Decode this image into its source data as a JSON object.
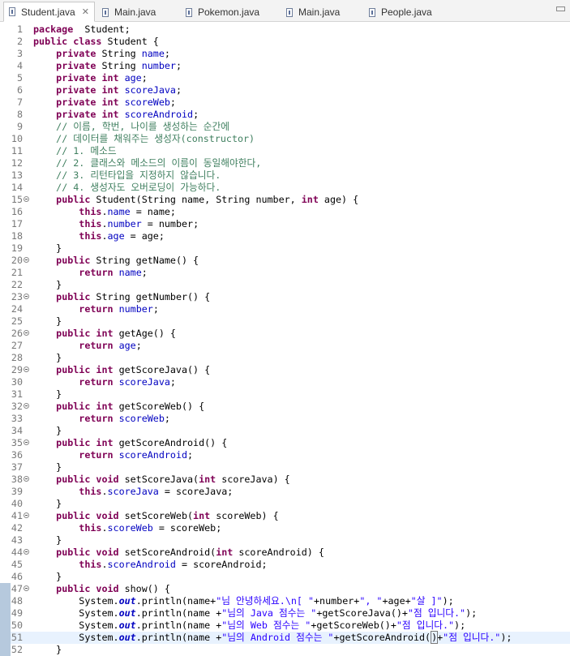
{
  "tabs": [
    {
      "label": "Student.java",
      "active": true,
      "close": "✕"
    },
    {
      "label": "Main.java",
      "active": false
    },
    {
      "label": "Pokemon.java",
      "active": false
    },
    {
      "label": "Main.java",
      "active": false
    },
    {
      "label": "People.java",
      "active": false
    }
  ],
  "code_lines": [
    {
      "n": "1",
      "t": [
        [
          "kw",
          "package"
        ],
        [
          "",
          "  Student;"
        ]
      ]
    },
    {
      "n": "2",
      "t": [
        [
          "kw",
          "public class"
        ],
        [
          "",
          " Student {"
        ]
      ]
    },
    {
      "n": "3",
      "t": [
        [
          "",
          "    "
        ],
        [
          "kw",
          "private"
        ],
        [
          "",
          " String "
        ],
        [
          "fld",
          "name"
        ],
        [
          "",
          ";"
        ]
      ]
    },
    {
      "n": "4",
      "t": [
        [
          "",
          "    "
        ],
        [
          "kw",
          "private"
        ],
        [
          "",
          " String "
        ],
        [
          "fld",
          "number"
        ],
        [
          "",
          ";"
        ]
      ]
    },
    {
      "n": "5",
      "t": [
        [
          "",
          "    "
        ],
        [
          "kw",
          "private int"
        ],
        [
          "",
          " "
        ],
        [
          "fld",
          "age"
        ],
        [
          "",
          ";"
        ]
      ]
    },
    {
      "n": "6",
      "t": [
        [
          "",
          "    "
        ],
        [
          "kw",
          "private int"
        ],
        [
          "",
          " "
        ],
        [
          "fld",
          "scoreJava"
        ],
        [
          "",
          ";"
        ]
      ]
    },
    {
      "n": "7",
      "t": [
        [
          "",
          "    "
        ],
        [
          "kw",
          "private int"
        ],
        [
          "",
          " "
        ],
        [
          "fld",
          "scoreWeb"
        ],
        [
          "",
          ";"
        ]
      ]
    },
    {
      "n": "8",
      "t": [
        [
          "",
          "    "
        ],
        [
          "kw",
          "private int"
        ],
        [
          "",
          " "
        ],
        [
          "fld",
          "scoreAndroid"
        ],
        [
          "",
          ";"
        ]
      ]
    },
    {
      "n": "9",
      "t": [
        [
          "",
          "    "
        ],
        [
          "cmt",
          "// 이름, 학번, 나이를 생성하는 순간에"
        ]
      ]
    },
    {
      "n": "10",
      "t": [
        [
          "",
          "    "
        ],
        [
          "cmt",
          "// 데이터를 채워주는 생성자(constructor)"
        ]
      ]
    },
    {
      "n": "11",
      "t": [
        [
          "",
          "    "
        ],
        [
          "cmt",
          "// 1. 메소드"
        ]
      ]
    },
    {
      "n": "12",
      "t": [
        [
          "",
          "    "
        ],
        [
          "cmt",
          "// 2. 클래스와 메소드의 이름이 동일해야한다,"
        ]
      ]
    },
    {
      "n": "13",
      "t": [
        [
          "",
          "    "
        ],
        [
          "cmt",
          "// 3. 리턴타입을 지정하지 않습니다."
        ]
      ]
    },
    {
      "n": "14",
      "t": [
        [
          "",
          "    "
        ],
        [
          "cmt",
          "// 4. 생성자도 오버로딩이 가능하다."
        ]
      ]
    },
    {
      "n": "15",
      "fold": true,
      "t": [
        [
          "",
          "    "
        ],
        [
          "kw",
          "public"
        ],
        [
          "",
          " Student(String name, String number, "
        ],
        [
          "kw",
          "int"
        ],
        [
          "",
          " age) {"
        ]
      ]
    },
    {
      "n": "16",
      "t": [
        [
          "",
          "        "
        ],
        [
          "kw",
          "this"
        ],
        [
          "",
          "."
        ],
        [
          "fld",
          "name"
        ],
        [
          "",
          " = name;"
        ]
      ]
    },
    {
      "n": "17",
      "t": [
        [
          "",
          "        "
        ],
        [
          "kw",
          "this"
        ],
        [
          "",
          "."
        ],
        [
          "fld",
          "number"
        ],
        [
          "",
          " = number;"
        ]
      ]
    },
    {
      "n": "18",
      "t": [
        [
          "",
          "        "
        ],
        [
          "kw",
          "this"
        ],
        [
          "",
          "."
        ],
        [
          "fld",
          "age"
        ],
        [
          "",
          " = age;"
        ]
      ]
    },
    {
      "n": "19",
      "t": [
        [
          "",
          "    }"
        ]
      ]
    },
    {
      "n": "20",
      "fold": true,
      "t": [
        [
          "",
          "    "
        ],
        [
          "kw",
          "public"
        ],
        [
          "",
          " String getName() {"
        ]
      ]
    },
    {
      "n": "21",
      "t": [
        [
          "",
          "        "
        ],
        [
          "kw",
          "return"
        ],
        [
          "",
          " "
        ],
        [
          "fld",
          "name"
        ],
        [
          "",
          ";"
        ]
      ]
    },
    {
      "n": "22",
      "t": [
        [
          "",
          "    }"
        ]
      ]
    },
    {
      "n": "23",
      "fold": true,
      "t": [
        [
          "",
          "    "
        ],
        [
          "kw",
          "public"
        ],
        [
          "",
          " String getNumber() {"
        ]
      ]
    },
    {
      "n": "24",
      "t": [
        [
          "",
          "        "
        ],
        [
          "kw",
          "return"
        ],
        [
          "",
          " "
        ],
        [
          "fld",
          "number"
        ],
        [
          "",
          ";"
        ]
      ]
    },
    {
      "n": "25",
      "t": [
        [
          "",
          "    }"
        ]
      ]
    },
    {
      "n": "26",
      "fold": true,
      "t": [
        [
          "",
          "    "
        ],
        [
          "kw",
          "public int"
        ],
        [
          "",
          " getAge() {"
        ]
      ]
    },
    {
      "n": "27",
      "t": [
        [
          "",
          "        "
        ],
        [
          "kw",
          "return"
        ],
        [
          "",
          " "
        ],
        [
          "fld",
          "age"
        ],
        [
          "",
          ";"
        ]
      ]
    },
    {
      "n": "28",
      "t": [
        [
          "",
          "    }"
        ]
      ]
    },
    {
      "n": "29",
      "fold": true,
      "t": [
        [
          "",
          "    "
        ],
        [
          "kw",
          "public int"
        ],
        [
          "",
          " getScoreJava() {"
        ]
      ]
    },
    {
      "n": "30",
      "t": [
        [
          "",
          "        "
        ],
        [
          "kw",
          "return"
        ],
        [
          "",
          " "
        ],
        [
          "fld",
          "scoreJava"
        ],
        [
          "",
          ";"
        ]
      ]
    },
    {
      "n": "31",
      "t": [
        [
          "",
          "    }"
        ]
      ]
    },
    {
      "n": "32",
      "fold": true,
      "t": [
        [
          "",
          "    "
        ],
        [
          "kw",
          "public int"
        ],
        [
          "",
          " getScoreWeb() {"
        ]
      ]
    },
    {
      "n": "33",
      "t": [
        [
          "",
          "        "
        ],
        [
          "kw",
          "return"
        ],
        [
          "",
          " "
        ],
        [
          "fld",
          "scoreWeb"
        ],
        [
          "",
          ";"
        ]
      ]
    },
    {
      "n": "34",
      "t": [
        [
          "",
          "    }"
        ]
      ]
    },
    {
      "n": "35",
      "fold": true,
      "t": [
        [
          "",
          "    "
        ],
        [
          "kw",
          "public int"
        ],
        [
          "",
          " getScoreAndroid() {"
        ]
      ]
    },
    {
      "n": "36",
      "t": [
        [
          "",
          "        "
        ],
        [
          "kw",
          "return"
        ],
        [
          "",
          " "
        ],
        [
          "fld",
          "scoreAndroid"
        ],
        [
          "",
          ";"
        ]
      ]
    },
    {
      "n": "37",
      "t": [
        [
          "",
          "    }"
        ]
      ]
    },
    {
      "n": "38",
      "fold": true,
      "t": [
        [
          "",
          "    "
        ],
        [
          "kw",
          "public void"
        ],
        [
          "",
          " setScoreJava("
        ],
        [
          "kw",
          "int"
        ],
        [
          "",
          " scoreJava) {"
        ]
      ]
    },
    {
      "n": "39",
      "t": [
        [
          "",
          "        "
        ],
        [
          "kw",
          "this"
        ],
        [
          "",
          "."
        ],
        [
          "fld",
          "scoreJava"
        ],
        [
          "",
          " = scoreJava;"
        ]
      ]
    },
    {
      "n": "40",
      "t": [
        [
          "",
          "    }"
        ]
      ]
    },
    {
      "n": "41",
      "fold": true,
      "t": [
        [
          "",
          "    "
        ],
        [
          "kw",
          "public void"
        ],
        [
          "",
          " setScoreWeb("
        ],
        [
          "kw",
          "int"
        ],
        [
          "",
          " scoreWeb) {"
        ]
      ]
    },
    {
      "n": "42",
      "t": [
        [
          "",
          "        "
        ],
        [
          "kw",
          "this"
        ],
        [
          "",
          "."
        ],
        [
          "fld",
          "scoreWeb"
        ],
        [
          "",
          " = scoreWeb;"
        ]
      ]
    },
    {
      "n": "43",
      "t": [
        [
          "",
          "    }"
        ]
      ]
    },
    {
      "n": "44",
      "fold": true,
      "t": [
        [
          "",
          "    "
        ],
        [
          "kw",
          "public void"
        ],
        [
          "",
          " setScoreAndroid("
        ],
        [
          "kw",
          "int"
        ],
        [
          "",
          " scoreAndroid) {"
        ]
      ]
    },
    {
      "n": "45",
      "t": [
        [
          "",
          "        "
        ],
        [
          "kw",
          "this"
        ],
        [
          "",
          "."
        ],
        [
          "fld",
          "scoreAndroid"
        ],
        [
          "",
          " = scoreAndroid;"
        ]
      ]
    },
    {
      "n": "46",
      "t": [
        [
          "",
          "    }"
        ]
      ]
    },
    {
      "n": "47",
      "fold": true,
      "mark": true,
      "t": [
        [
          "",
          "    "
        ],
        [
          "kw",
          "public void"
        ],
        [
          "",
          " show() {"
        ]
      ]
    },
    {
      "n": "48",
      "mark": true,
      "t": [
        [
          "",
          "        System."
        ],
        [
          "out",
          "out"
        ],
        [
          "",
          ".println(name+"
        ],
        [
          "str",
          "\"님 안녕하세요.\\n[ \""
        ],
        [
          "",
          "+number+"
        ],
        [
          "str",
          "\", \""
        ],
        [
          "",
          "+age+"
        ],
        [
          "str",
          "\"살 ]\""
        ],
        [
          "",
          ");"
        ]
      ]
    },
    {
      "n": "49",
      "mark": true,
      "t": [
        [
          "",
          "        System."
        ],
        [
          "out",
          "out"
        ],
        [
          "",
          ".println(name +"
        ],
        [
          "str",
          "\"님의 Java 점수는 \""
        ],
        [
          "",
          "+getScoreJava()+"
        ],
        [
          "str",
          "\"점 입니다.\""
        ],
        [
          "",
          ");"
        ]
      ]
    },
    {
      "n": "50",
      "mark": true,
      "t": [
        [
          "",
          "        System."
        ],
        [
          "out",
          "out"
        ],
        [
          "",
          ".println(name +"
        ],
        [
          "str",
          "\"님의 Web 점수는 \""
        ],
        [
          "",
          "+getScoreWeb()+"
        ],
        [
          "str",
          "\"점 입니다.\""
        ],
        [
          "",
          ");"
        ]
      ]
    },
    {
      "n": "51",
      "mark": true,
      "current": true,
      "t": [
        [
          "",
          "        System."
        ],
        [
          "out",
          "out"
        ],
        [
          "",
          ".println(name +"
        ],
        [
          "str",
          "\"님의 Android 점수는 \""
        ],
        [
          "",
          "+getScoreAndroid("
        ],
        [
          "caret",
          ""
        ],
        [
          "bracket",
          ")"
        ],
        [
          "",
          "+"
        ],
        [
          "str",
          "\"점 입니다.\""
        ],
        [
          "",
          ");"
        ]
      ]
    },
    {
      "n": "52",
      "mark": true,
      "t": [
        [
          "",
          "    }"
        ]
      ]
    }
  ],
  "colors": {
    "keyword": "#7f0055",
    "field": "#0000c0",
    "string": "#2a00ff",
    "comment": "#3f7f5f",
    "current_line": "#e8f2fe"
  }
}
